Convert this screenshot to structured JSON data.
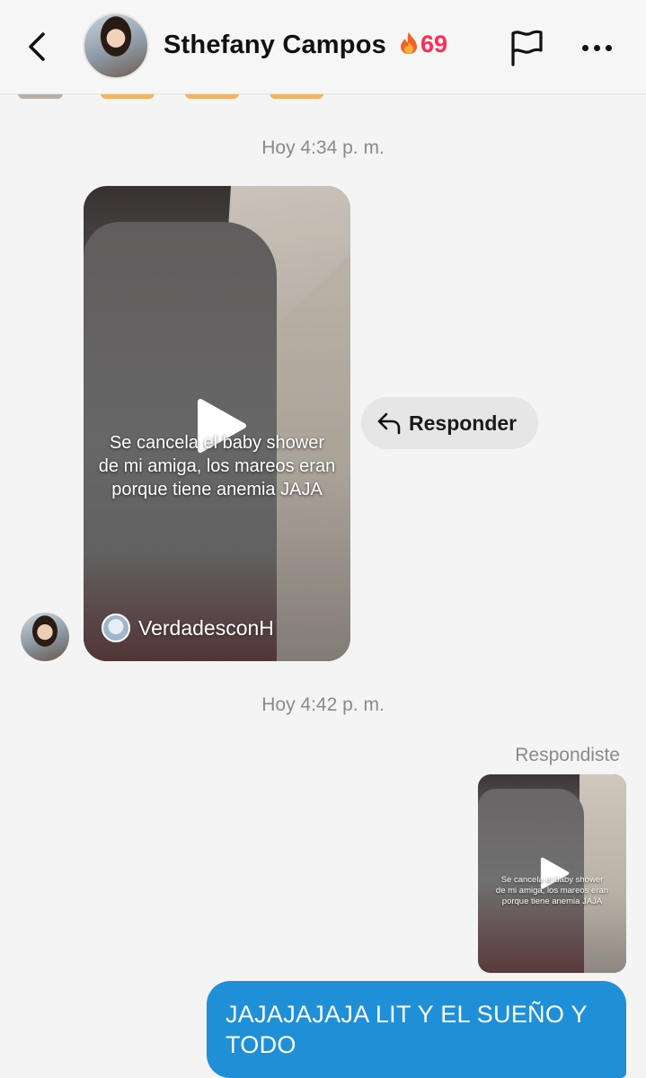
{
  "header": {
    "contact_name": "Sthefany Campos",
    "streak_count": "69",
    "icons": [
      "back-icon",
      "flame-icon",
      "flag-icon",
      "more-icon"
    ]
  },
  "messages": {
    "timestamp_1": "Hoy 4:34 p. m.",
    "video": {
      "caption_line1": "Se cancela el baby shower",
      "caption_line2": "de mi amiga, los mareos eran",
      "caption_line3": "porque tiene anemia JAJA",
      "author": "VerdadesconH"
    },
    "reply_button": "Responder",
    "timestamp_2": "Hoy 4:42 p. m.",
    "replied_label": "Respondiste",
    "mini_video": {
      "caption_line1": "Se cancela el baby shower",
      "caption_line2": "de mi amiga, los mareos eran",
      "caption_line3": "porque tiene anemia JAJA"
    },
    "sent_text": "JAJAJAJAJA LIT Y EL SUEÑO Y TODO"
  },
  "colors": {
    "streak": "#fe2c55",
    "sent_bubble": "#1f8fd8",
    "background": "#f4f4f4"
  }
}
